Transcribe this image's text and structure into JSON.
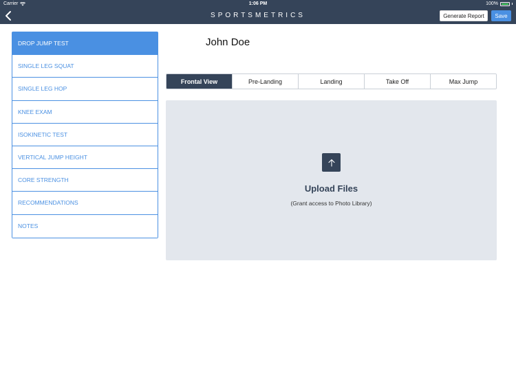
{
  "status_bar": {
    "carrier": "Carrier",
    "time": "1:06 PM",
    "battery": "100%"
  },
  "nav": {
    "title": "SPORTSMETRICS",
    "back_icon": "chevron-left-icon",
    "generate_report_label": "Generate Report",
    "save_label": "Save"
  },
  "sidebar": {
    "items": [
      {
        "label": "DROP JUMP TEST",
        "active": true
      },
      {
        "label": "SINGLE LEG SQUAT",
        "active": false
      },
      {
        "label": "SINGLE LEG HOP",
        "active": false
      },
      {
        "label": "KNEE EXAM",
        "active": false
      },
      {
        "label": "ISOKINETIC TEST",
        "active": false
      },
      {
        "label": "VERTICAL JUMP HEIGHT",
        "active": false
      },
      {
        "label": "CORE STRENGTH",
        "active": false
      },
      {
        "label": "RECOMMENDATIONS",
        "active": false
      },
      {
        "label": "NOTES",
        "active": false
      }
    ]
  },
  "main": {
    "patient_name": "John Doe",
    "tabs": [
      {
        "label": "Frontal View",
        "active": true
      },
      {
        "label": "Pre-Landing",
        "active": false
      },
      {
        "label": "Landing",
        "active": false
      },
      {
        "label": "Take Off",
        "active": false
      },
      {
        "label": "Max Jump",
        "active": false
      }
    ],
    "upload": {
      "icon": "upload-arrow-icon",
      "title": "Upload Files",
      "subtitle": "(Grant access to Photo Library)"
    }
  },
  "colors": {
    "nav_bg": "#354459",
    "accent": "#4a90e2",
    "upload_bg": "#e3e7ed"
  }
}
